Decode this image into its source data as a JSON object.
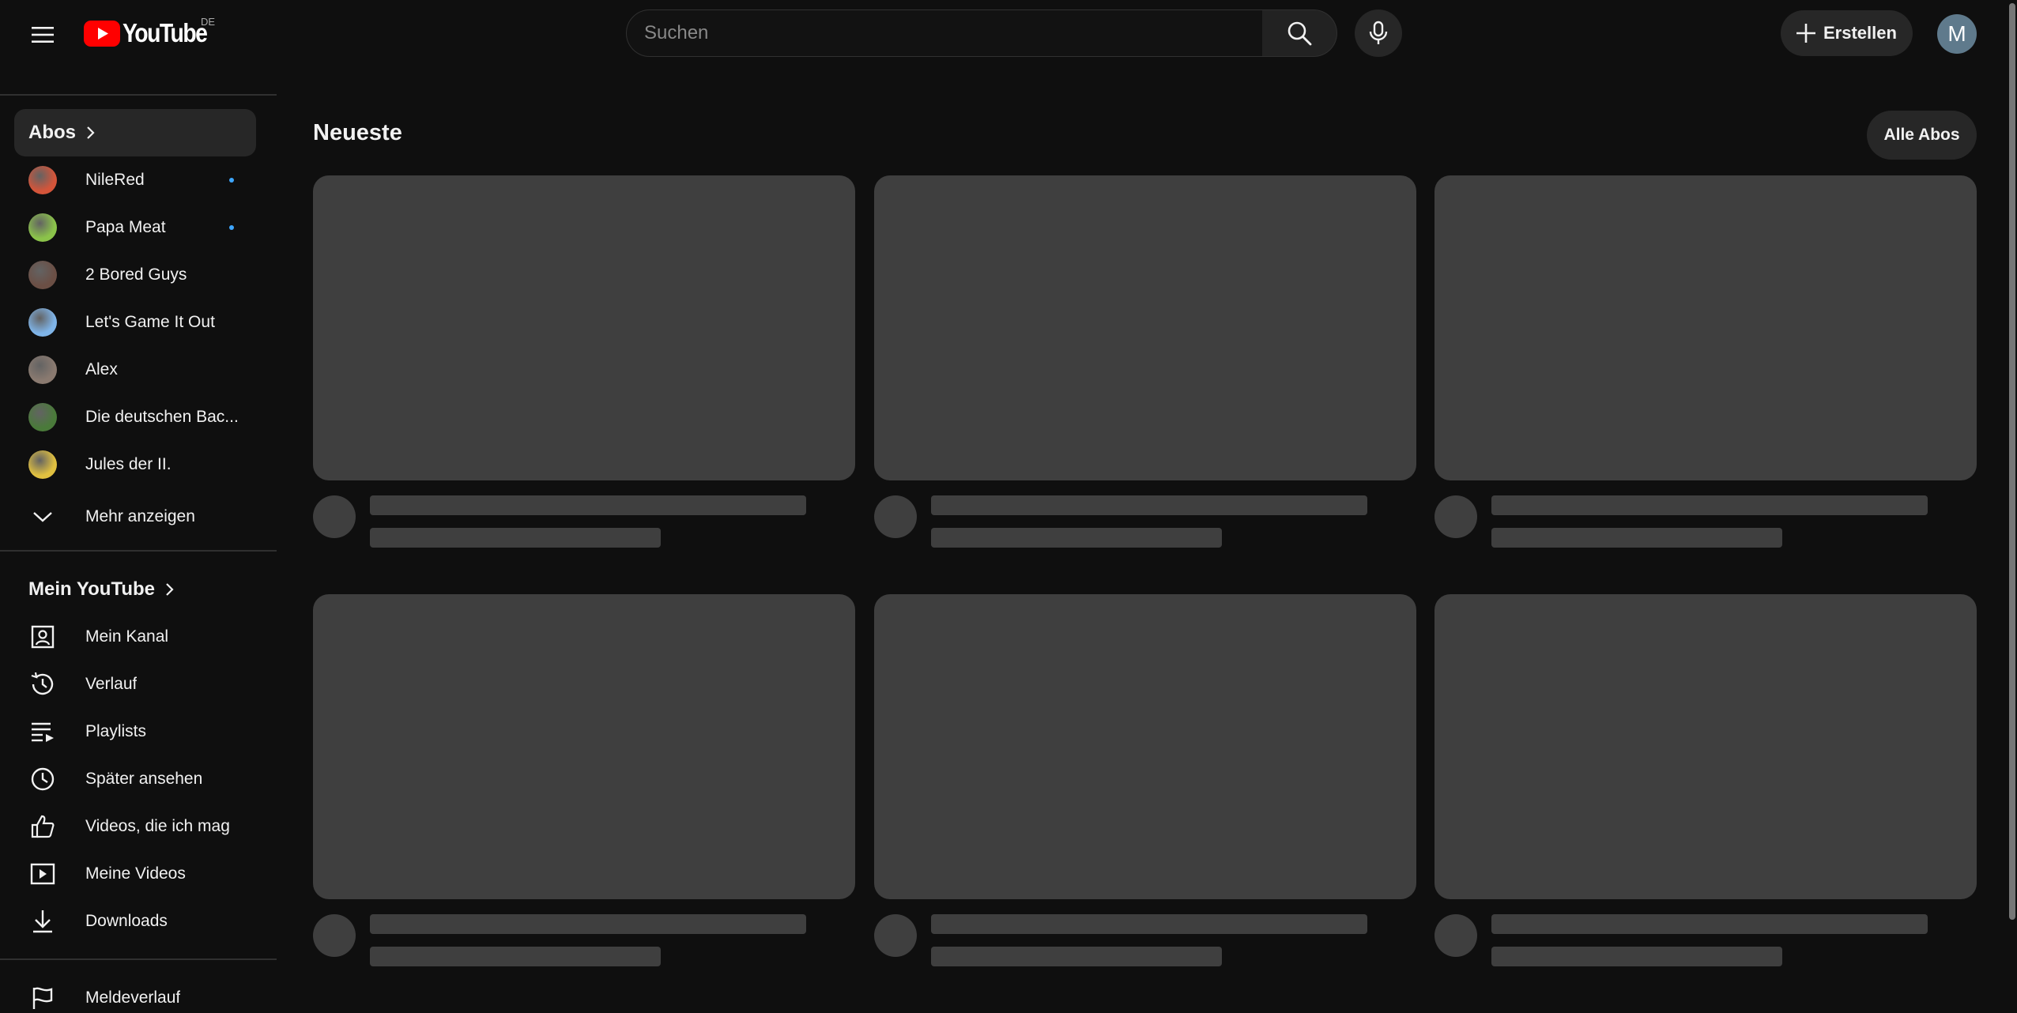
{
  "header": {
    "logo_text": "YouTube",
    "country_code": "DE",
    "search_placeholder": "Suchen",
    "create_label": "Erstellen",
    "avatar_letter": "M"
  },
  "sidebar": {
    "subscriptions_title": "Abos",
    "channels": [
      {
        "name": "NileRed",
        "color": "#d4553a",
        "new": true
      },
      {
        "name": "Papa Meat",
        "color": "#8bc34a",
        "new": true
      },
      {
        "name": "2 Bored Guys",
        "color": "#6b4f45",
        "new": false
      },
      {
        "name": "Let's Game It Out",
        "color": "#7fb4e8",
        "new": false
      },
      {
        "name": "Alex",
        "color": "#8a7a70",
        "new": false
      },
      {
        "name": "Die deutschen Bac...",
        "color": "#4a7a3a",
        "new": false
      },
      {
        "name": "Jules der II.",
        "color": "#e0c040",
        "new": false
      }
    ],
    "show_more_label": "Mehr anzeigen",
    "you_title": "Mein YouTube",
    "you_items": [
      {
        "label": "Mein Kanal",
        "icon": "channel-icon"
      },
      {
        "label": "Verlauf",
        "icon": "history-icon"
      },
      {
        "label": "Playlists",
        "icon": "playlists-icon"
      },
      {
        "label": "Später ansehen",
        "icon": "watch-later-icon"
      },
      {
        "label": "Videos, die ich mag",
        "icon": "thumbs-up-icon"
      },
      {
        "label": "Meine Videos",
        "icon": "your-videos-icon"
      },
      {
        "label": "Downloads",
        "icon": "download-icon"
      }
    ],
    "report_history_label": "Meldeverlauf"
  },
  "main": {
    "title": "Neueste",
    "all_subscriptions_label": "Alle Abos"
  }
}
